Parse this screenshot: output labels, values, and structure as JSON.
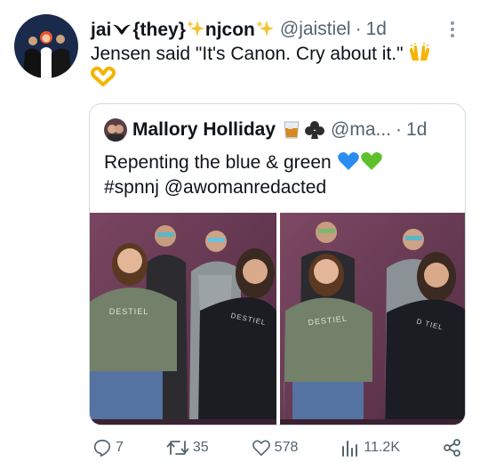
{
  "tweet": {
    "author_name": "jai",
    "name_middle": "{they}",
    "name_end": "njcon",
    "handle": "@jaistiel",
    "separator": "·",
    "time": "1d",
    "text": "Jensen said \"It's Canon. Cry about it.\"",
    "emojis": [
      "raised-hands-emoji",
      "heart-hands-emoji"
    ]
  },
  "quote": {
    "author_name": "Mallory Holliday",
    "author_emojis": [
      "whiskey-glass-emoji",
      "club-suit-emoji"
    ],
    "handle": "@ma...",
    "separator": "·",
    "time": "1d",
    "line1": "Repenting the blue & green",
    "line1_emojis": [
      "blue-heart-emoji",
      "green-heart-emoji"
    ],
    "line2": "#spnnj @awomanredacted",
    "sweater_print": "DESTIEL"
  },
  "actions": {
    "replies": "7",
    "retweets": "35",
    "likes": "578",
    "views": "11.2K"
  },
  "colors": {
    "text": "#0f1419",
    "secondary": "#536471",
    "border": "#cfd9de",
    "backdrop": "#6b3a56",
    "sweater_green": "#73806a"
  }
}
